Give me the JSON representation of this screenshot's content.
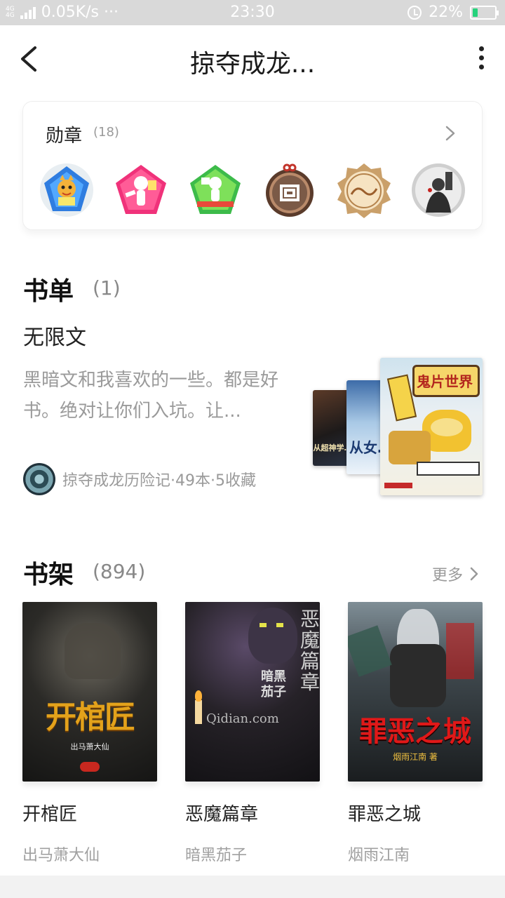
{
  "status_bar": {
    "net_top": "4G 4G",
    "speed": "0.05K/s ···",
    "time": "23:30",
    "battery": "22%",
    "battery_level": 0.22,
    "accent": "#27d27c"
  },
  "nav": {
    "title": "掠夺成龙...",
    "back_icon": "back-arrow-icon",
    "more_icon": "more-vertical-icon"
  },
  "medals": {
    "title": "勋章",
    "count": "(18)",
    "items": [
      {
        "icon": "medal-reader-cat-icon"
      },
      {
        "icon": "medal-pink-pentagon-icon"
      },
      {
        "icon": "medal-green-pentagon-icon"
      },
      {
        "icon": "medal-bronze-seal-icon"
      },
      {
        "icon": "medal-gold-seal-icon"
      },
      {
        "icon": "medal-warrior-portrait-icon"
      }
    ]
  },
  "booklist": {
    "title": "书单",
    "count": "(1)",
    "name": "无限文",
    "desc": "黑暗文和我喜欢的一些。都是好书。绝对让你们入坑。让...",
    "author_line": "掠夺成龙历险记·49本·5收藏",
    "covers": [
      "从超神学…",
      "从女…",
      "鬼片世界"
    ]
  },
  "bookshelf": {
    "title": "书架",
    "count": "(894)",
    "more": "更多",
    "books": [
      {
        "title": "开棺匠",
        "author": "出马萧大仙",
        "cover_text": "开棺匠",
        "cover_sub": "出马萧大仙"
      },
      {
        "title": "恶魔篇章",
        "author": "暗黑茄子",
        "cover_text": "恶魔篇章",
        "cover_sub": "暗黑茄子",
        "watermark": "Qidian.com"
      },
      {
        "title": "罪恶之城",
        "author": "烟雨江南",
        "cover_text": "罪恶之城",
        "cover_sub": "烟雨江南 著"
      }
    ]
  }
}
